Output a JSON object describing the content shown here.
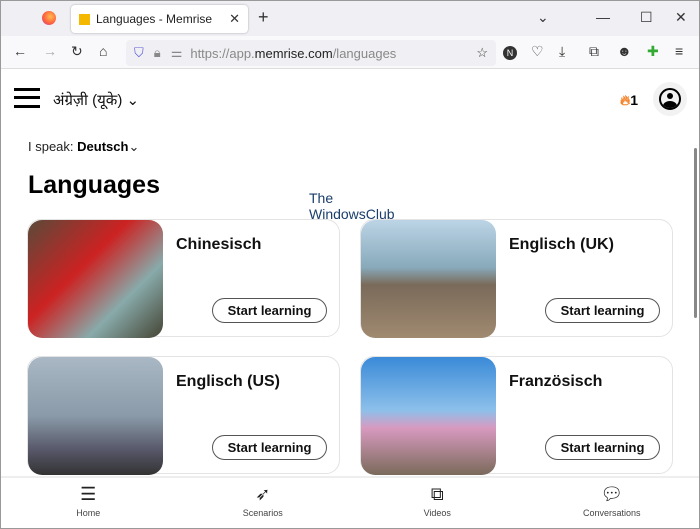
{
  "browser": {
    "tab_title": "Languages - Memrise",
    "url_prefix": "https://app.",
    "url_domain": "memrise.com",
    "url_path": "/languages"
  },
  "header": {
    "language": "अंग्रेज़ी (यूके)",
    "streak": "1"
  },
  "speak": {
    "label": "I speak:",
    "value": "Deutsch"
  },
  "title": "Languages",
  "watermark": [
    "The",
    "WindowsClub"
  ],
  "courses": [
    {
      "name": "Chinesisch",
      "button": "Start learning"
    },
    {
      "name": "Englisch (UK)",
      "button": "Start learning"
    },
    {
      "name": "Englisch (US)",
      "button": "Start learning"
    },
    {
      "name": "Französisch",
      "button": "Start learning"
    }
  ],
  "bottom_nav": [
    {
      "label": "Home"
    },
    {
      "label": "Scenarios"
    },
    {
      "label": "Videos"
    },
    {
      "label": "Conversations"
    }
  ]
}
